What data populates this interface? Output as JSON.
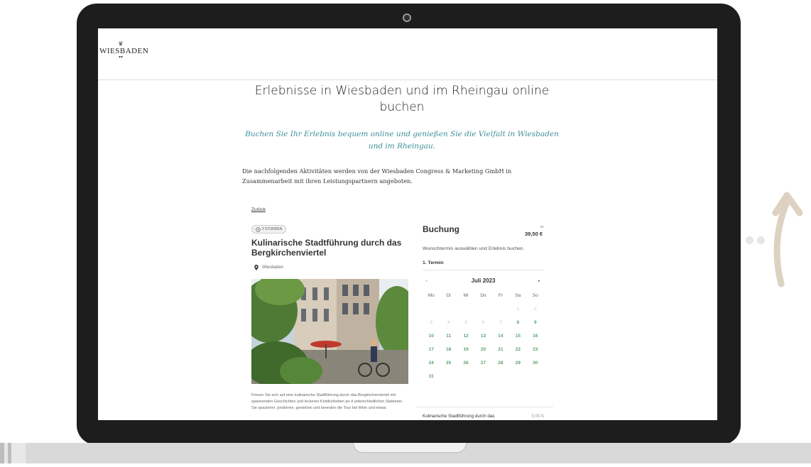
{
  "site": {
    "logo": {
      "name": "WIESBADEN",
      "crown": "♛",
      "sub": "▾▾"
    },
    "heading": "Erlebnisse in Wiesbaden und im Rheingau online buchen",
    "subheading": "Buchen Sie Ihr Erlebnis bequem online und genießen Sie die Vielfalt in Wiesbaden und im Rheingau.",
    "intro": "Die nachfolgenden Aktivitäten werden von der Wiesbaden Congress & Marketing GmbH in Zusammenarbeit mit ihren Leistungspartnern angeboten.",
    "back_link": "Zurück"
  },
  "tour": {
    "duration": "2 STUNDEN",
    "title": "Kulinarische Stadtführung durch das Bergkirchenviertel",
    "location": "Wiesbaden",
    "description": "Freuen Sie sich auf eine kulinarische Stadtführung durch das Bergkirchenviertel mit spannenden Geschichten und leckeren Köstlichkeiten an 4 unterschiedlichen Stationen. Sie spazieren, probieren, genießen und beenden die Tour bei Wein und etwas"
  },
  "booking": {
    "title": "Buchung",
    "price_prefix": "Ab",
    "price": "39,50 €",
    "hint": "Wunschtermin auswählen und Erlebnis buchen.",
    "step": "1. Termin",
    "calendar": {
      "prev_icon": "◂",
      "next_icon": "▸",
      "month": "Juli 2023",
      "weekdays": [
        "Mo",
        "Di",
        "Mi",
        "Do",
        "Fr",
        "Sa",
        "So"
      ],
      "days": [
        "",
        "",
        "",
        "",
        "",
        "1",
        "2",
        "3",
        "4",
        "5",
        "6",
        "7",
        "8",
        "9",
        "10",
        "11",
        "12",
        "13",
        "14",
        "15",
        "16",
        "17",
        "18",
        "19",
        "20",
        "21",
        "22",
        "23",
        "24",
        "25",
        "26",
        "27",
        "28",
        "29",
        "30",
        "31",
        "",
        "",
        "",
        "",
        "",
        ""
      ],
      "unavailable_days": [
        "1",
        "2",
        "3",
        "4",
        "5",
        "6",
        "7"
      ]
    },
    "summary": {
      "label": "Kulinarische Stadtführung durch das",
      "amount": "0,00 €"
    }
  },
  "colors": {
    "accent_teal": "#3d8f9a",
    "available_day": "#5aa36a",
    "laptop_frame": "#1d1d1d"
  }
}
